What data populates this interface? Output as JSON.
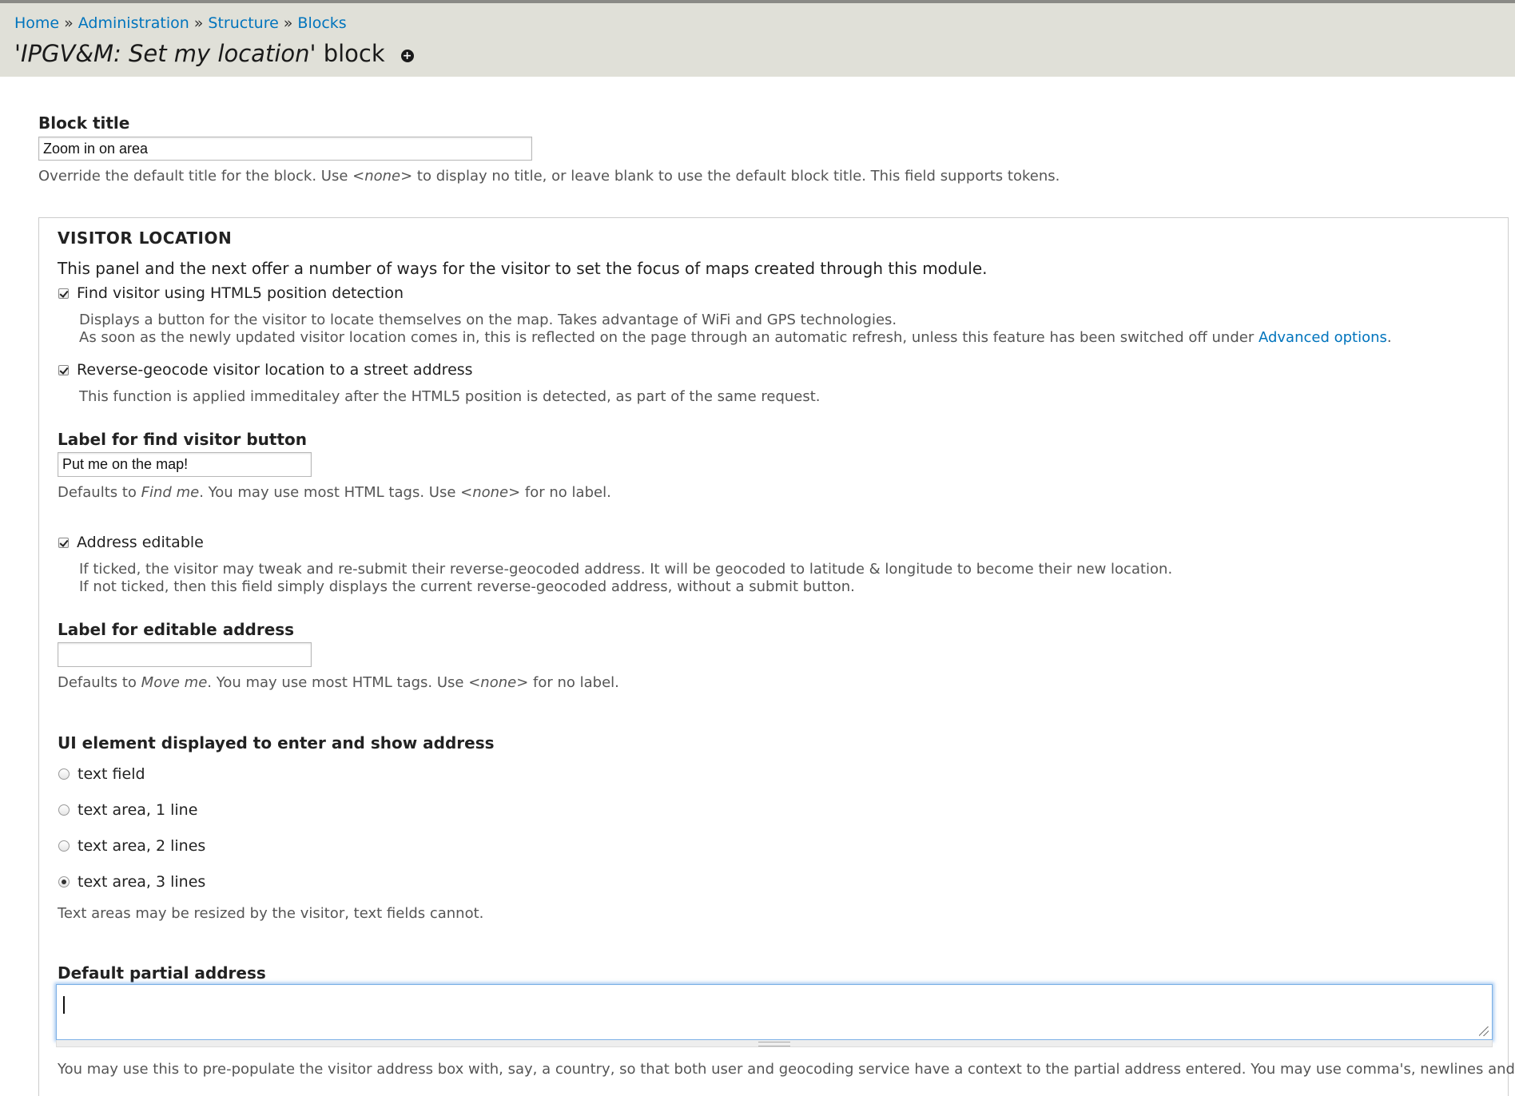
{
  "breadcrumb": {
    "items": [
      "Home",
      "Administration",
      "Structure",
      "Blocks"
    ],
    "separator": "»"
  },
  "page_title": {
    "quote_open": "'",
    "italic": "IPGV&M: Set my location",
    "quote_close": "'",
    "suffix": " block"
  },
  "block_title": {
    "label": "Block title",
    "value": "Zoom in on area",
    "desc_before": "Override the default title for the block. Use ",
    "desc_em": "<none>",
    "desc_after": " to display no title, or leave blank to use the default block title. This field supports tokens."
  },
  "visitor_location": {
    "legend": "VISITOR LOCATION",
    "intro": "This panel and the next offer a number of ways for the visitor to set the focus of maps created through this module.",
    "html5": {
      "label": "Find visitor using HTML5 position detection",
      "checked": true,
      "desc_line1": "Displays a button for the visitor to locate themselves on the map. Takes advantage of WiFi and GPS technologies.",
      "desc_line2_before": "As soon as the newly updated visitor location comes in, this is reflected on the page through an automatic refresh, unless this feature has been switched off under ",
      "desc_link": "Advanced options",
      "desc_line2_after": "."
    },
    "reverse_geocode": {
      "label": "Reverse-geocode visitor location to a street address",
      "checked": true,
      "desc": "This function is applied immeditaley after the HTML5 position is detected, as part of the same request."
    },
    "find_button_label": {
      "label": "Label for find visitor button",
      "value": "Put me on the map!",
      "desc_before": "Defaults to ",
      "desc_em1": "Find me",
      "desc_mid": ". You may use most HTML tags. Use ",
      "desc_em2": "<none>",
      "desc_after": " for no label."
    },
    "address_editable": {
      "label": "Address editable",
      "checked": true,
      "desc_line1": "If ticked, the visitor may tweak and re-submit their reverse-geocoded address. It will be geocoded to latitude & longitude to become their new location.",
      "desc_line2": "If not ticked, then this field simply displays the current reverse-geocoded address, without a submit button."
    },
    "editable_address_label": {
      "label": "Label for editable address",
      "value": "",
      "desc_before": "Defaults to ",
      "desc_em1": "Move me",
      "desc_mid": ". You may use most HTML tags. Use ",
      "desc_em2": "<none>",
      "desc_after": " for no label."
    },
    "ui_element": {
      "label": "UI element displayed to enter and show address",
      "options": [
        "text field",
        "text area, 1 line",
        "text area, 2 lines",
        "text area, 3 lines"
      ],
      "selected": "text area, 3 lines",
      "desc": "Text areas may be resized by the visitor, text fields cannot."
    },
    "default_partial_address": {
      "label": "Default partial address",
      "value": "",
      "desc": "You may use this to pre-populate the visitor address box with, say, a country, so that both user and geocoding service have a context to the partial address entered. You may use comma's, newlines and"
    }
  },
  "colors": {
    "link": "#0074bd",
    "header_bg": "#e0e0d8",
    "focus_ring": "#7bb0e6"
  },
  "icons": {
    "shortcut": "plus-circle-icon",
    "checkbox": "checkbox-icon",
    "radio": "radio-icon"
  }
}
